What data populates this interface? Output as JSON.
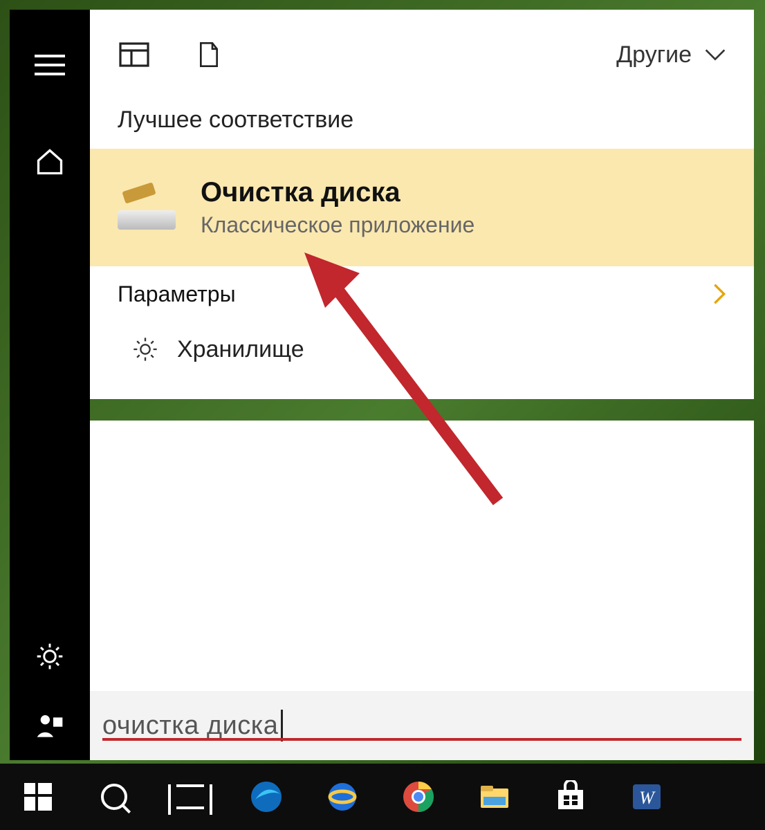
{
  "filter": {
    "more_label": "Другие"
  },
  "results": {
    "best_match_header": "Лучшее соответствие",
    "best_match": {
      "title": "Очистка диска",
      "subtitle": "Классическое приложение"
    },
    "settings_header": "Параметры",
    "settings_items": [
      {
        "icon": "gear",
        "label": "Хранилище"
      }
    ]
  },
  "search": {
    "query": "очистка диска"
  },
  "colors": {
    "highlight_bg": "#fbe8af",
    "accent": "#e5a50a",
    "annotation": "#c1272d"
  }
}
